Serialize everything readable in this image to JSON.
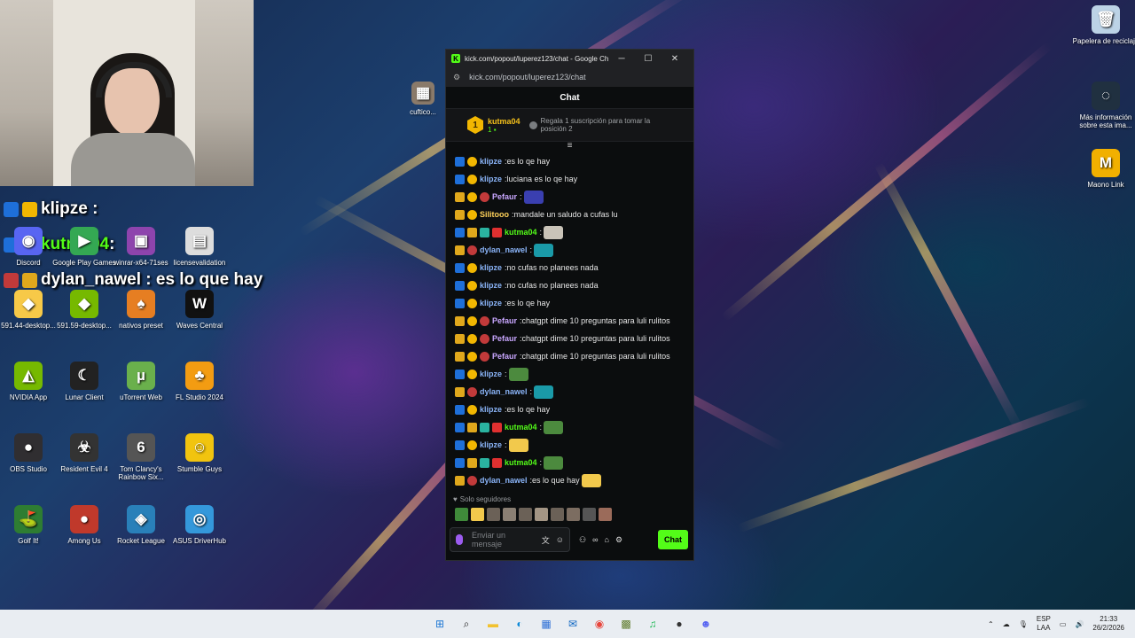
{
  "overlay": {
    "lines": [
      {
        "user": "klipze",
        "text": " : "
      },
      {
        "user": "kutma04",
        "text": ":"
      },
      {
        "user": "dylan_nawel",
        "text": " : es lo que hay"
      }
    ]
  },
  "desktop": {
    "icons": [
      {
        "label": "Discord",
        "glyph": "◉",
        "color": "#5865f2",
        "icon": "discord-icon"
      },
      {
        "label": "Google Play Games",
        "glyph": "▶",
        "color": "#34a853",
        "icon": "google-play-games-icon"
      },
      {
        "label": "winrar-x64-71ses",
        "glyph": "▣",
        "color": "#8e44ad",
        "icon": "winrar-icon"
      },
      {
        "label": "licensevalidation",
        "glyph": "▤",
        "color": "#dddddd",
        "icon": "file-icon"
      },
      {
        "label": "591.44-desktop...",
        "glyph": "◆",
        "color": "#f7c948",
        "icon": "installer-icon"
      },
      {
        "label": "591.59-desktop...",
        "glyph": "◆",
        "color": "#76b900",
        "icon": "nvidia-installer-icon"
      },
      {
        "label": "nativos preset",
        "glyph": "♠",
        "color": "#e67e22",
        "icon": "fl-preset-icon"
      },
      {
        "label": "Waves Central",
        "glyph": "W",
        "color": "#111111",
        "icon": "waves-icon"
      },
      {
        "label": "NVIDIA App",
        "glyph": "◭",
        "color": "#76b900",
        "icon": "nvidia-icon"
      },
      {
        "label": "Lunar Client",
        "glyph": "☾",
        "color": "#222222",
        "icon": "lunar-client-icon"
      },
      {
        "label": "uTorrent Web",
        "glyph": "µ",
        "color": "#6ab04c",
        "icon": "utorrent-icon"
      },
      {
        "label": "FL Studio 2024",
        "glyph": "♣",
        "color": "#f39c12",
        "icon": "fl-studio-icon"
      },
      {
        "label": "OBS Studio",
        "glyph": "●",
        "color": "#302e31",
        "icon": "obs-icon"
      },
      {
        "label": "Resident Evil 4",
        "glyph": "☣",
        "color": "#333333",
        "icon": "resident-evil-icon"
      },
      {
        "label": "Tom Clancy's Rainbow Six...",
        "glyph": "6",
        "color": "#555555",
        "icon": "rainbow-six-icon"
      },
      {
        "label": "Stumble Guys",
        "glyph": "☺",
        "color": "#f1c40f",
        "icon": "stumble-guys-icon"
      },
      {
        "label": "Golf It!",
        "glyph": "⛳",
        "color": "#2e7d32",
        "icon": "golf-it-icon"
      },
      {
        "label": "Among Us",
        "glyph": "●",
        "color": "#c0392b",
        "icon": "among-us-icon"
      },
      {
        "label": "Rocket League",
        "glyph": "◈",
        "color": "#2980b9",
        "icon": "rocket-league-icon"
      },
      {
        "label": "ASUS DriverHub",
        "glyph": "◎",
        "color": "#3498db",
        "icon": "asus-driverhub-icon"
      }
    ],
    "right_icons": [
      {
        "label": "Papelera de reciclaje",
        "glyph": "🗑",
        "color": "#bcd3e6",
        "icon": "recycle-bin-icon"
      },
      {
        "label": "Más información sobre esta ima...",
        "glyph": "◌",
        "color": "#203040",
        "icon": "spotlight-icon"
      },
      {
        "label": "Maono Link",
        "glyph": "M",
        "color": "#f1b000",
        "icon": "maono-link-icon"
      }
    ],
    "small_label": "cuftico..."
  },
  "browser": {
    "title": "kick.com/popout/luperez123/chat - Google Ch...",
    "url": "kick.com/popout/luperez123/chat",
    "controls": {
      "minimize": "─",
      "maximize": "☐",
      "close": "✕"
    }
  },
  "chat": {
    "header": "Chat",
    "pinned": {
      "rank": "1",
      "user": "kutma04",
      "count": "1",
      "gift_text": "Regala 1 suscripción para tomar la posición 2"
    },
    "messages": [
      {
        "badges": [
          "mod",
          "fol"
        ],
        "user": "klipze",
        "color": "#8ab4f8",
        "text": "es lo qe hay",
        "emote": ""
      },
      {
        "badges": [
          "mod",
          "fol"
        ],
        "user": "klipze",
        "color": "#8ab4f8",
        "text": "luciana es lo qe hay",
        "emote": ""
      },
      {
        "badges": [
          "crown",
          "fol",
          "vip"
        ],
        "user": "Pefaur",
        "color": "#c9a7ff",
        "text": "",
        "emote": "#3a3fb0"
      },
      {
        "badges": [
          "crown",
          "fol"
        ],
        "user": "Silitooo",
        "color": "#ffd25a",
        "text": "mandale un saludo a cufas lu",
        "emote": ""
      },
      {
        "badges": [
          "mod",
          "crown",
          "og",
          "sub"
        ],
        "user": "kutma04",
        "color": "#53fc18",
        "text": "",
        "emote": "#c9c3b8"
      },
      {
        "badges": [
          "crown",
          "vip"
        ],
        "user": "dylan_nawel",
        "color": "#8ab4f8",
        "text": "",
        "emote": "#1a9aa8"
      },
      {
        "badges": [
          "mod",
          "fol"
        ],
        "user": "klipze",
        "color": "#8ab4f8",
        "text": "no cufas no planees nada",
        "emote": ""
      },
      {
        "badges": [
          "mod",
          "fol"
        ],
        "user": "klipze",
        "color": "#8ab4f8",
        "text": "no cufas no planees nada",
        "emote": ""
      },
      {
        "badges": [
          "mod",
          "fol"
        ],
        "user": "klipze",
        "color": "#8ab4f8",
        "text": "es lo qe hay",
        "emote": ""
      },
      {
        "badges": [
          "crown",
          "fol",
          "vip"
        ],
        "user": "Pefaur",
        "color": "#c9a7ff",
        "text": "chatgpt dime 10 preguntas para luli rulitos",
        "emote": ""
      },
      {
        "badges": [
          "crown",
          "fol",
          "vip"
        ],
        "user": "Pefaur",
        "color": "#c9a7ff",
        "text": "chatgpt dime 10 preguntas para luli rulitos",
        "emote": ""
      },
      {
        "badges": [
          "crown",
          "fol",
          "vip"
        ],
        "user": "Pefaur",
        "color": "#c9a7ff",
        "text": "chatgpt dime 10 preguntas para luli rulitos",
        "emote": ""
      },
      {
        "badges": [
          "mod",
          "fol"
        ],
        "user": "klipze",
        "color": "#8ab4f8",
        "text": "",
        "emote": "#4c8a3e"
      },
      {
        "badges": [
          "crown",
          "vip"
        ],
        "user": "dylan_nawel",
        "color": "#8ab4f8",
        "text": "",
        "emote": "#1a9aa8"
      },
      {
        "badges": [
          "mod",
          "fol"
        ],
        "user": "klipze",
        "color": "#8ab4f8",
        "text": "es lo qe hay",
        "emote": ""
      },
      {
        "badges": [
          "mod",
          "crown",
          "og",
          "sub"
        ],
        "user": "kutma04",
        "color": "#53fc18",
        "text": "",
        "emote": "#4c8a3e"
      },
      {
        "badges": [
          "mod",
          "fol"
        ],
        "user": "klipze",
        "color": "#8ab4f8",
        "text": "",
        "emote": "#f2c94c"
      },
      {
        "badges": [
          "mod",
          "crown",
          "og",
          "sub"
        ],
        "user": "kutma04",
        "color": "#53fc18",
        "text": "",
        "emote": "#4c8a3e"
      },
      {
        "badges": [
          "crown",
          "vip"
        ],
        "user": "dylan_nawel",
        "color": "#8ab4f8",
        "text": "es lo que hay",
        "emote": "#f2c94c"
      }
    ],
    "followers_only": "Solo seguidores",
    "input_placeholder": "Enviar un mensaje",
    "send_label": "Chat"
  },
  "taskbar": {
    "apps": [
      {
        "glyph": "⊞",
        "color": "#1e78d4",
        "icon": "windows-start-icon"
      },
      {
        "glyph": "⌕",
        "color": "#222222",
        "icon": "search-icon"
      },
      {
        "glyph": "▬",
        "color": "#f2c230",
        "icon": "file-explorer-icon"
      },
      {
        "glyph": "◐",
        "color": "#0f8ad8",
        "icon": "edge-icon"
      },
      {
        "glyph": "▦",
        "color": "#2d6fd6",
        "icon": "store-icon"
      },
      {
        "glyph": "✉",
        "color": "#0a64c2",
        "icon": "outlook-icon"
      },
      {
        "glyph": "◉",
        "color": "#e8453c",
        "icon": "chrome-icon"
      },
      {
        "glyph": "▩",
        "color": "#5d7a2a",
        "icon": "minecraft-icon"
      },
      {
        "glyph": "♫",
        "color": "#1db954",
        "icon": "spotify-icon"
      },
      {
        "glyph": "●",
        "color": "#333333",
        "icon": "obs-taskbar-icon"
      },
      {
        "glyph": "☻",
        "color": "#5865f2",
        "icon": "discord-taskbar-icon"
      }
    ],
    "lang_top": "ESP",
    "lang_bottom": "LAA",
    "time": "21:33",
    "date": "26/2/2026"
  },
  "colors": {
    "kick_green": "#53fc18",
    "chat_bg": "#0b0d0e"
  }
}
